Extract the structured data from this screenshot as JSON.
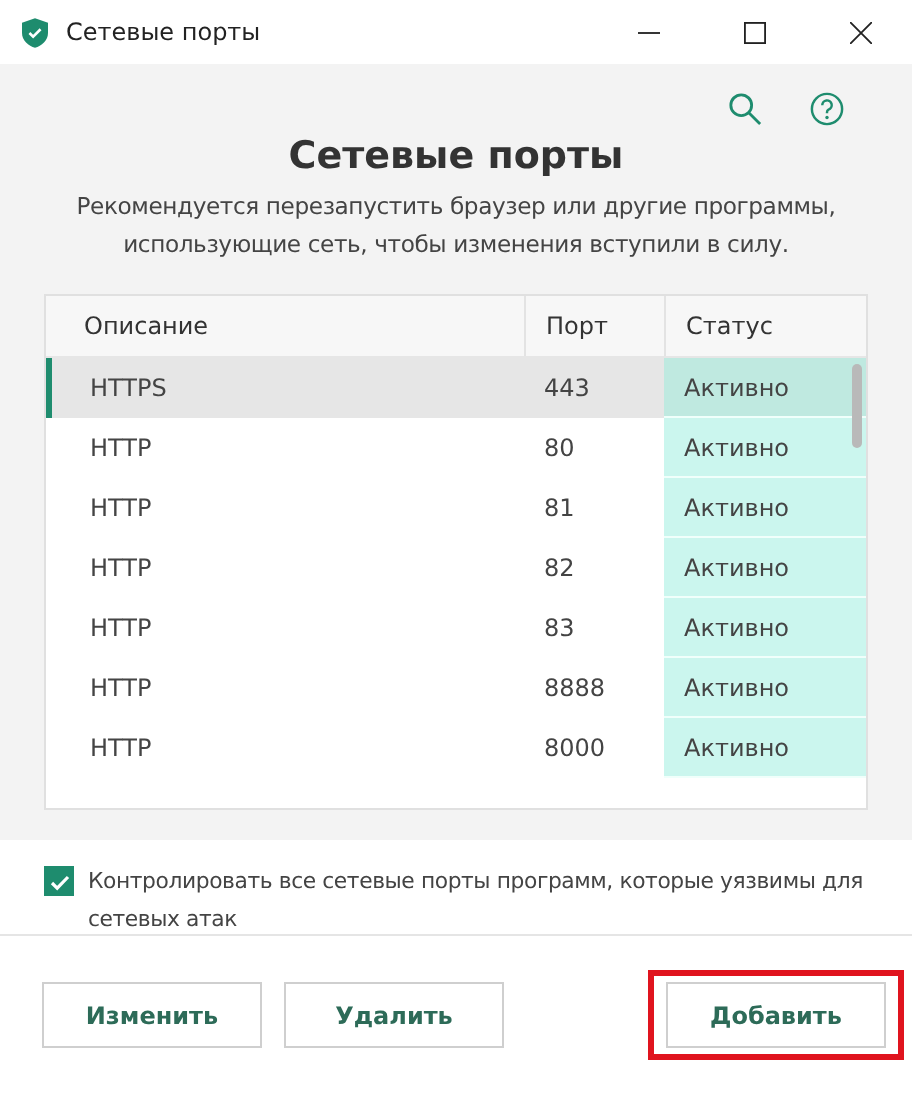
{
  "window": {
    "title": "Сетевые порты"
  },
  "heading": "Сетевые порты",
  "subtitle": "Рекомендуется перезапустить браузер или другие программы, использующие сеть, чтобы изменения вступили в силу.",
  "table": {
    "columns": [
      "Описание",
      "Порт",
      "Статус"
    ],
    "rows": [
      {
        "description": "HTTPS",
        "port": "443",
        "status": "Активно",
        "selected": true
      },
      {
        "description": "HTTP",
        "port": "80",
        "status": "Активно",
        "selected": false
      },
      {
        "description": "HTTP",
        "port": "81",
        "status": "Активно",
        "selected": false
      },
      {
        "description": "HTTP",
        "port": "82",
        "status": "Активно",
        "selected": false
      },
      {
        "description": "HTTP",
        "port": "83",
        "status": "Активно",
        "selected": false
      },
      {
        "description": "HTTP",
        "port": "8888",
        "status": "Активно",
        "selected": false
      },
      {
        "description": "HTTP",
        "port": "8000",
        "status": "Активно",
        "selected": false
      }
    ]
  },
  "monitor_all": {
    "label": "Контролировать все сетевые порты программ, которые уязвимы для сетевых атак",
    "checked": true
  },
  "buttons": [
    {
      "label": "Изменить",
      "highlighted": false
    },
    {
      "label": "Удалить",
      "highlighted": false
    },
    {
      "label": "Добавить",
      "highlighted": true
    }
  ]
}
